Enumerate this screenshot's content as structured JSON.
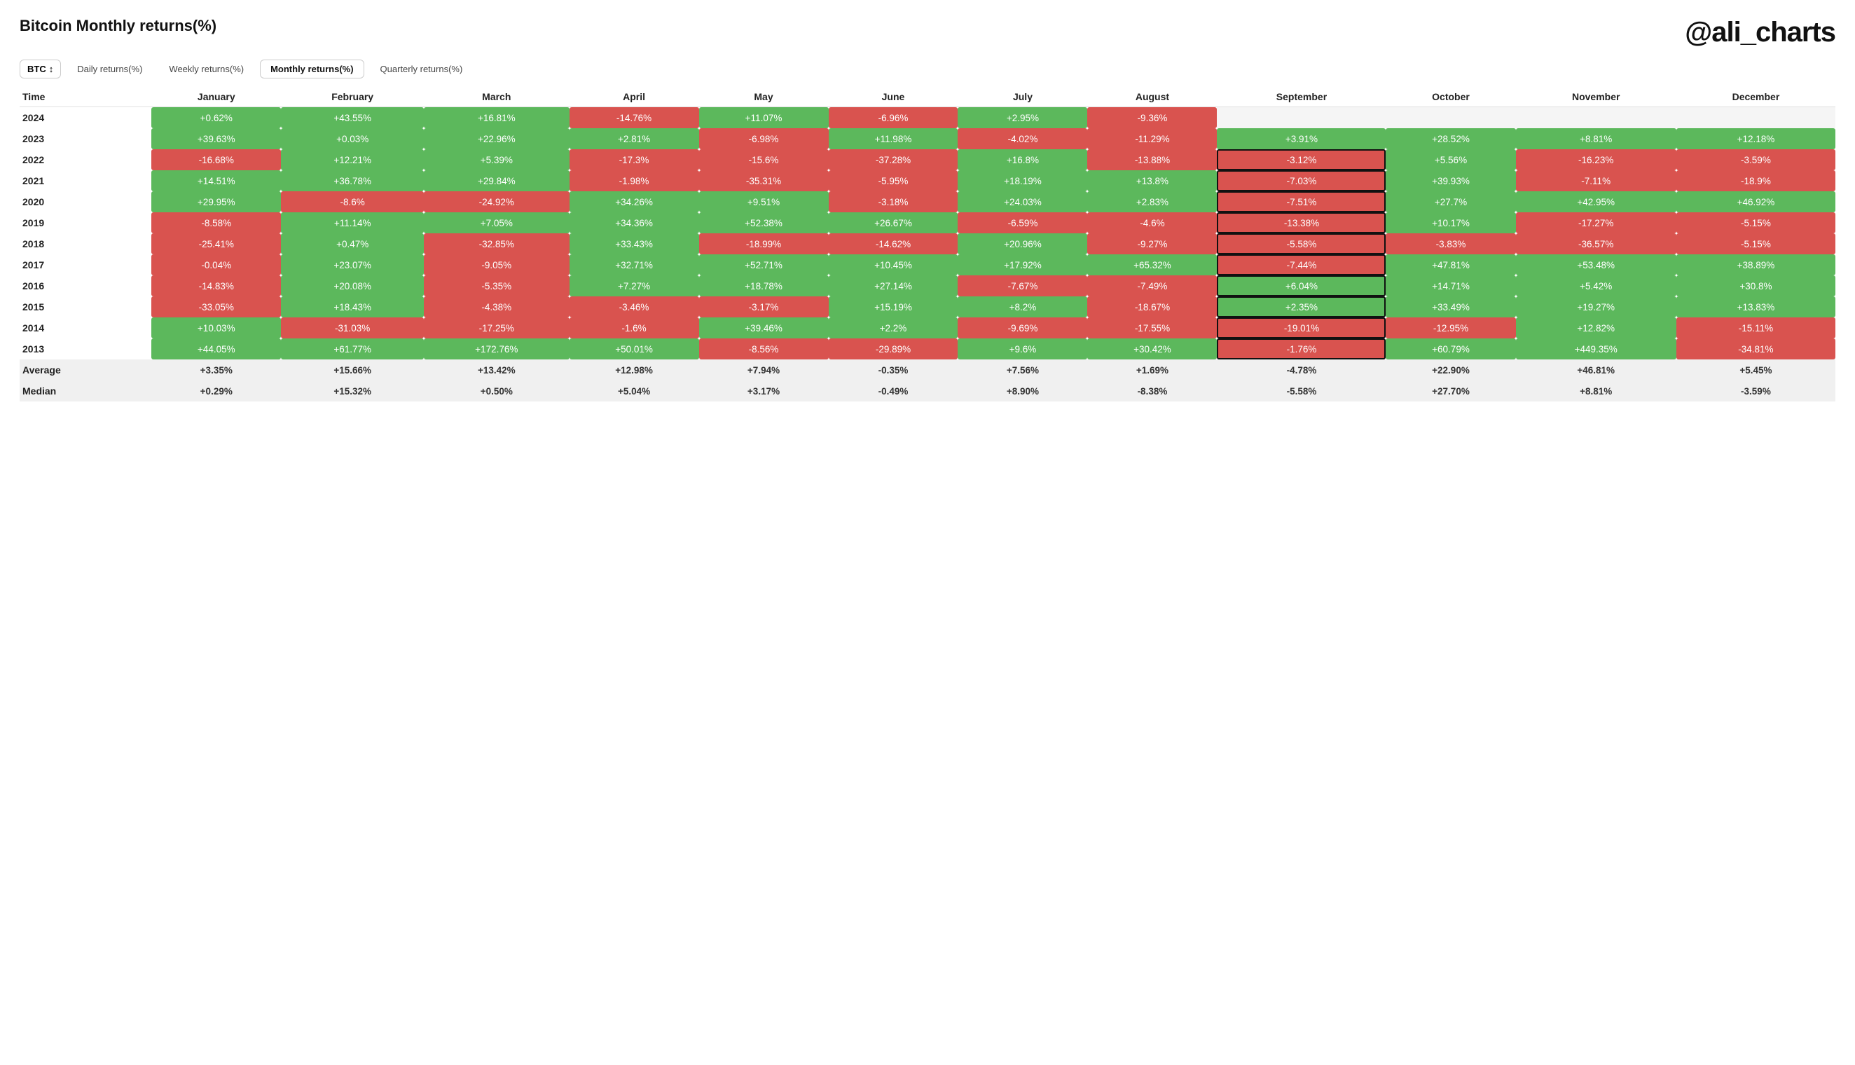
{
  "header": {
    "title": "Bitcoin Monthly returns(%)",
    "brand": "@ali_charts"
  },
  "controls": {
    "asset": "BTC",
    "tabs": [
      "Daily returns(%)",
      "Weekly returns(%)",
      "Monthly returns(%)",
      "Quarterly returns(%)"
    ],
    "active_tab": 2
  },
  "table": {
    "columns": [
      "Time",
      "January",
      "February",
      "March",
      "April",
      "May",
      "June",
      "July",
      "August",
      "September",
      "October",
      "November",
      "December"
    ],
    "rows": [
      {
        "year": "2024",
        "values": [
          "+0.62%",
          "+43.55%",
          "+16.81%",
          "-14.76%",
          "+11.07%",
          "-6.96%",
          "+2.95%",
          "-9.36%",
          "",
          "",
          "",
          ""
        ]
      },
      {
        "year": "2023",
        "values": [
          "+39.63%",
          "+0.03%",
          "+22.96%",
          "+2.81%",
          "-6.98%",
          "+11.98%",
          "-4.02%",
          "-11.29%",
          "+3.91%",
          "+28.52%",
          "+8.81%",
          "+12.18%"
        ]
      },
      {
        "year": "2022",
        "values": [
          "-16.68%",
          "+12.21%",
          "+5.39%",
          "-17.3%",
          "-15.6%",
          "-37.28%",
          "+16.8%",
          "-13.88%",
          "-3.12%",
          "+5.56%",
          "-16.23%",
          "-3.59%"
        ]
      },
      {
        "year": "2021",
        "values": [
          "+14.51%",
          "+36.78%",
          "+29.84%",
          "-1.98%",
          "-35.31%",
          "-5.95%",
          "+18.19%",
          "+13.8%",
          "-7.03%",
          "+39.93%",
          "-7.11%",
          "-18.9%"
        ]
      },
      {
        "year": "2020",
        "values": [
          "+29.95%",
          "-8.6%",
          "-24.92%",
          "+34.26%",
          "+9.51%",
          "-3.18%",
          "+24.03%",
          "+2.83%",
          "-7.51%",
          "+27.7%",
          "+42.95%",
          "+46.92%"
        ]
      },
      {
        "year": "2019",
        "values": [
          "-8.58%",
          "+11.14%",
          "+7.05%",
          "+34.36%",
          "+52.38%",
          "+26.67%",
          "-6.59%",
          "-4.6%",
          "-13.38%",
          "+10.17%",
          "-17.27%",
          "-5.15%"
        ]
      },
      {
        "year": "2018",
        "values": [
          "-25.41%",
          "+0.47%",
          "-32.85%",
          "+33.43%",
          "-18.99%",
          "-14.62%",
          "+20.96%",
          "-9.27%",
          "-5.58%",
          "-3.83%",
          "-36.57%",
          "-5.15%"
        ]
      },
      {
        "year": "2017",
        "values": [
          "-0.04%",
          "+23.07%",
          "-9.05%",
          "+32.71%",
          "+52.71%",
          "+10.45%",
          "+17.92%",
          "+65.32%",
          "-7.44%",
          "+47.81%",
          "+53.48%",
          "+38.89%"
        ]
      },
      {
        "year": "2016",
        "values": [
          "-14.83%",
          "+20.08%",
          "-5.35%",
          "+7.27%",
          "+18.78%",
          "+27.14%",
          "-7.67%",
          "-7.49%",
          "+6.04%",
          "+14.71%",
          "+5.42%",
          "+30.8%"
        ]
      },
      {
        "year": "2015",
        "values": [
          "-33.05%",
          "+18.43%",
          "-4.38%",
          "-3.46%",
          "-3.17%",
          "+15.19%",
          "+8.2%",
          "-18.67%",
          "+2.35%",
          "+33.49%",
          "+19.27%",
          "+13.83%"
        ]
      },
      {
        "year": "2014",
        "values": [
          "+10.03%",
          "-31.03%",
          "-17.25%",
          "-1.6%",
          "+39.46%",
          "+2.2%",
          "-9.69%",
          "-17.55%",
          "-19.01%",
          "-12.95%",
          "+12.82%",
          "-15.11%"
        ]
      },
      {
        "year": "2013",
        "values": [
          "+44.05%",
          "+61.77%",
          "+172.76%",
          "+50.01%",
          "-8.56%",
          "-29.89%",
          "+9.6%",
          "+30.42%",
          "-1.76%",
          "+60.79%",
          "+449.35%",
          "-34.81%"
        ]
      }
    ],
    "average": {
      "label": "Average",
      "values": [
        "+3.35%",
        "+15.66%",
        "+13.42%",
        "+12.98%",
        "+7.94%",
        "-0.35%",
        "+7.56%",
        "+1.69%",
        "-4.78%",
        "+22.90%",
        "+46.81%",
        "+5.45%"
      ]
    },
    "median": {
      "label": "Median",
      "values": [
        "+0.29%",
        "+15.32%",
        "+0.50%",
        "+5.04%",
        "+3.17%",
        "-0.49%",
        "+8.90%",
        "-8.38%",
        "-5.58%",
        "+27.70%",
        "+8.81%",
        "-3.59%"
      ]
    },
    "sep_highlight_years": [
      "2022",
      "2021",
      "2020",
      "2019",
      "2018",
      "2017",
      "2016",
      "2015",
      "2014",
      "2013"
    ]
  }
}
